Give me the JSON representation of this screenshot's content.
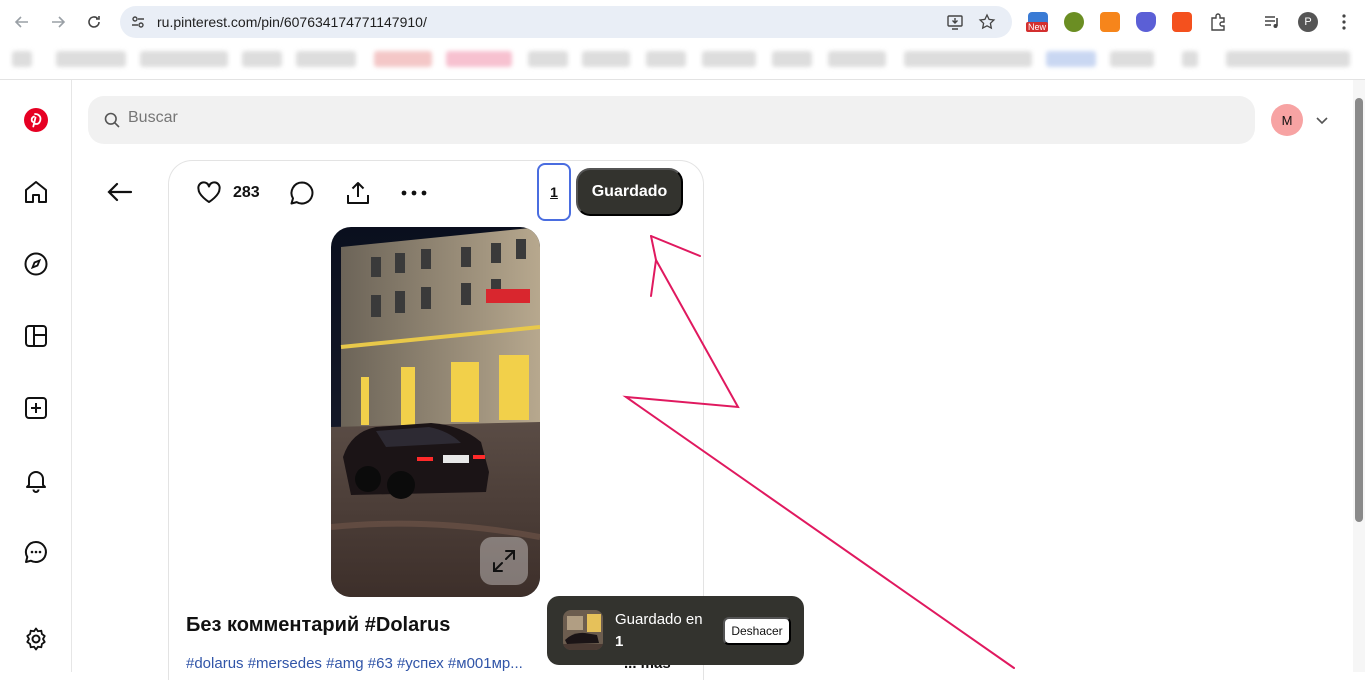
{
  "browser": {
    "url": "ru.pinterest.com/pin/607634174771147910/",
    "new_badge": "New",
    "profile_initial": "P"
  },
  "header": {
    "search_placeholder": "Buscar",
    "avatar_initial": "M"
  },
  "pin": {
    "likes": "283",
    "board_count": "1",
    "save_label": "Guardado",
    "title": "Без комментарий #Dolarus",
    "tags": "#dolarus #mersedes #amg #63 #успех #м001мр...",
    "more_label": "... más"
  },
  "toast": {
    "message": "Guardado en",
    "board": "1",
    "undo_label": "Deshacer"
  },
  "colors": {
    "pinterest_red": "#e60023",
    "annotation": "#e0195f",
    "dark_button": "#33332e",
    "focus_ring": "#4a6de0"
  },
  "icons": [
    "back-arrow-icon",
    "forward-arrow-icon",
    "reload-icon",
    "site-info-icon",
    "install-icon",
    "star-icon",
    "pinterest-logo-icon",
    "home-icon",
    "explore-icon",
    "boards-icon",
    "create-icon",
    "notifications-icon",
    "messages-icon",
    "settings-icon",
    "search-icon",
    "chevron-down-icon",
    "heart-icon",
    "comment-icon",
    "share-icon",
    "more-icon",
    "expand-icon"
  ]
}
